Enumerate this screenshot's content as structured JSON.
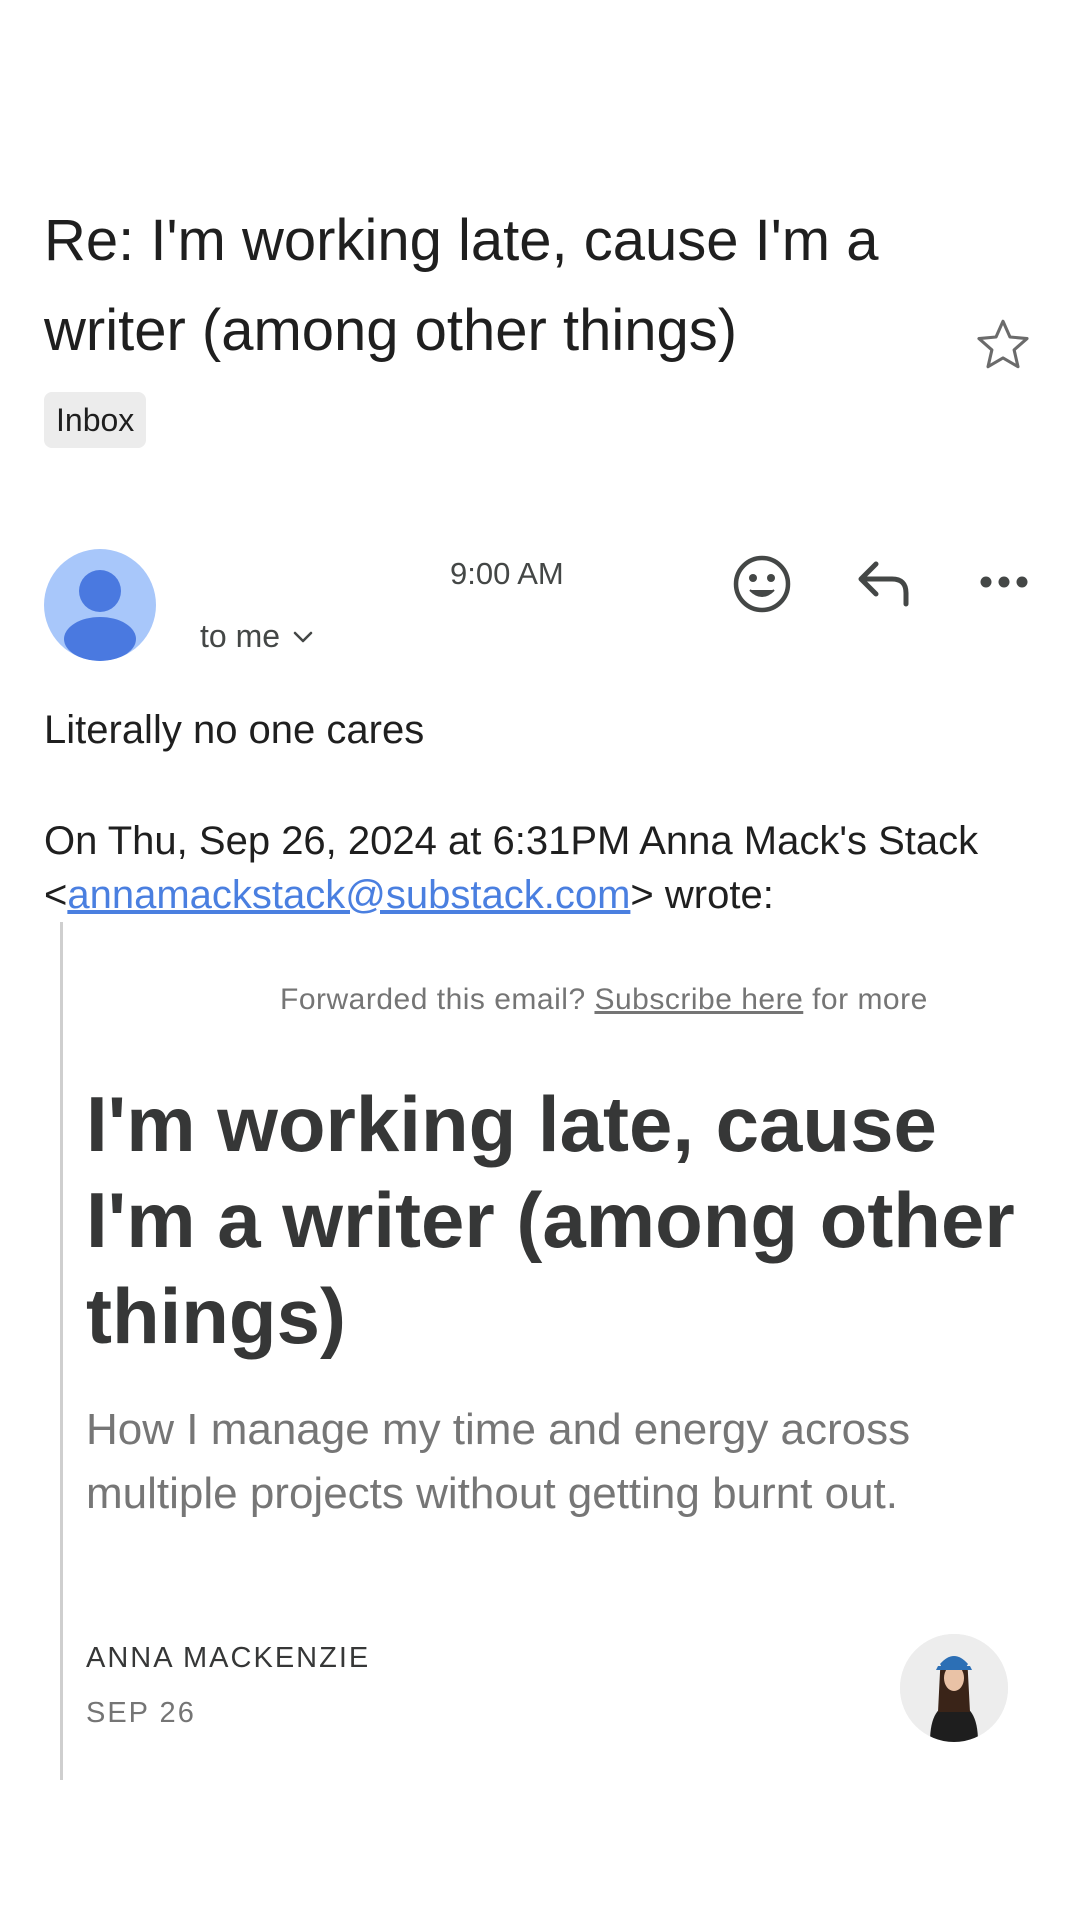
{
  "email": {
    "subject": "Re: I'm working late, cause I'm a writer (among other things)",
    "label": "Inbox",
    "time": "9:00 AM",
    "recipient": "to me",
    "body": "Literally no one cares",
    "quote_prefix": "On Thu, Sep 26, 2024 at 6:31PM Anna Mack's Stack <",
    "quote_email": "annamackstack@substack.com",
    "quote_suffix": "> wrote:"
  },
  "quoted": {
    "forwarded_prefix": "Forwarded this email? ",
    "subscribe_link": "Subscribe here",
    "forwarded_suffix": " for more",
    "title": "I'm working late, cause I'm a writer (among other things)",
    "subtitle": "How I manage my time and energy across multiple projects without getting burnt out.",
    "author": "ANNA MACKENZIE",
    "date": "SEP 26"
  },
  "icons": {
    "star": "star-outline-icon",
    "emoji": "smiley-icon",
    "reply": "reply-icon",
    "more": "more-horizontal-icon",
    "chevron": "chevron-down-icon",
    "avatar": "person-icon"
  },
  "colors": {
    "link": "#4a7fe0",
    "avatar_bg": "#a8c7fa",
    "avatar_fg": "#4a79e0",
    "chip_bg": "#ececec"
  }
}
